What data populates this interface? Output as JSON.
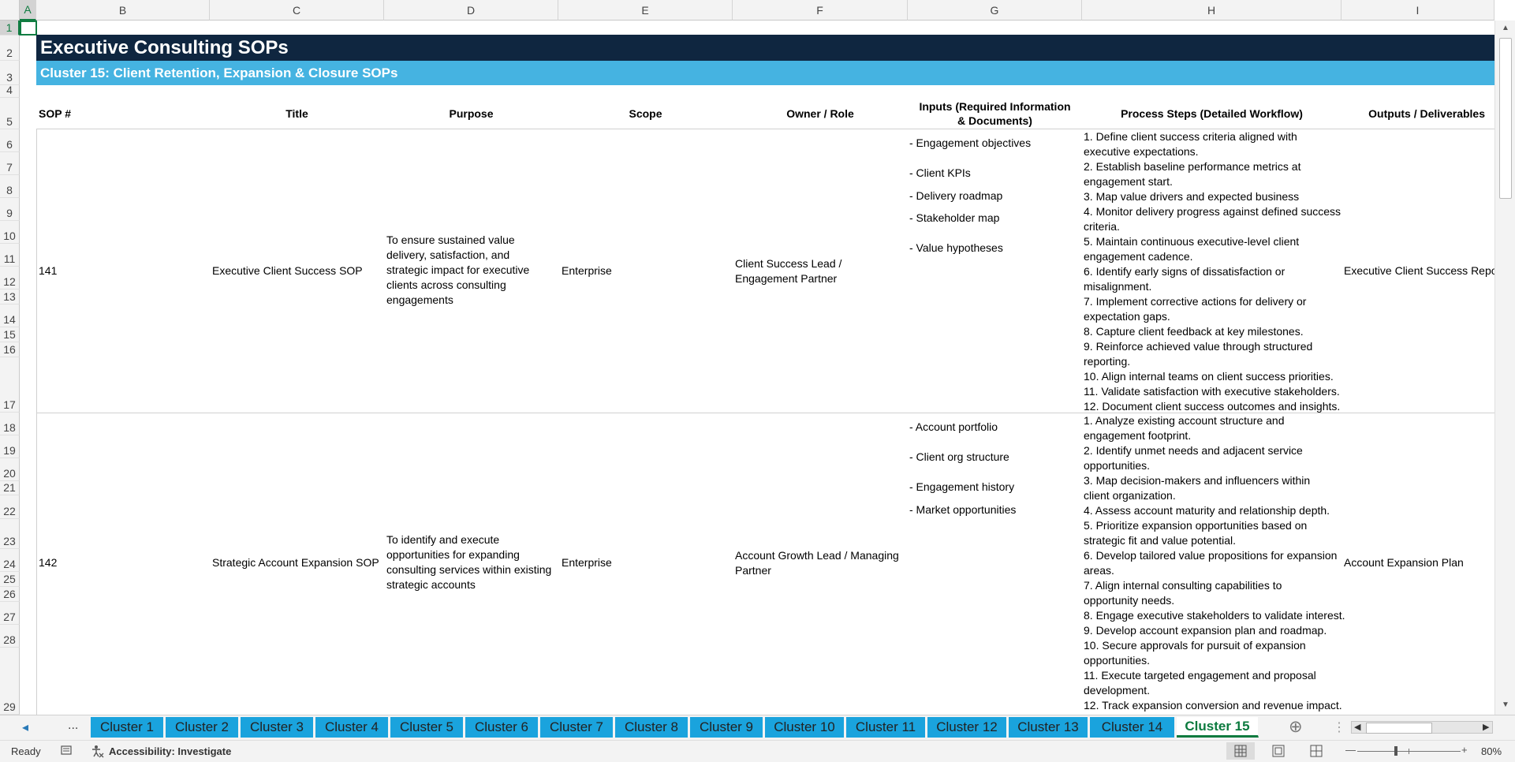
{
  "columns": [
    "A",
    "B",
    "C",
    "D",
    "E",
    "F",
    "G",
    "H",
    "I"
  ],
  "rows": [
    "1",
    "2",
    "3",
    "4",
    "5",
    "6",
    "7",
    "8",
    "9",
    "10",
    "11",
    "12",
    "13",
    "14",
    "15",
    "16",
    "17",
    "18",
    "19",
    "20",
    "21",
    "22",
    "23",
    "24",
    "25",
    "26",
    "27",
    "28",
    "29"
  ],
  "title": "Executive Consulting SOPs",
  "subtitle": "Cluster 15: Client Retention, Expansion & Closure SOPs",
  "headers": {
    "sop": "SOP #",
    "title": "Title",
    "purpose": "Purpose",
    "scope": "Scope",
    "owner": "Owner / Role",
    "inputs": "Inputs (Required Information & Documents)",
    "steps": "Process Steps (Detailed Workflow)",
    "outputs": "Outputs / Deliverables"
  },
  "records": [
    {
      "sop": "141",
      "title": "Executive Client Success SOP",
      "purpose": "To ensure sustained value delivery, satisfaction, and strategic impact for executive clients across consulting engagements",
      "scope": "Enterprise",
      "owner": "Client Success Lead / Engagement Partner",
      "inputs": [
        "- Engagement objectives",
        "- Client KPIs",
        "- Delivery roadmap",
        "- Stakeholder map",
        "- Value hypotheses"
      ],
      "steps": [
        [
          "1. Define client success criteria aligned with",
          "executive expectations."
        ],
        [
          "2. Establish baseline performance metrics at",
          "engagement start."
        ],
        [
          "3. Map value drivers and expected business"
        ],
        [
          "4. Monitor delivery progress against defined success",
          "criteria."
        ],
        [
          "5. Maintain continuous executive-level client",
          "engagement cadence."
        ],
        [
          "6. Identify early signs of dissatisfaction or",
          "misalignment."
        ],
        [
          "7. Implement corrective actions for delivery or",
          "expectation gaps."
        ],
        [
          "8. Capture client feedback at key milestones."
        ],
        [
          "9. Reinforce achieved value through structured",
          "reporting."
        ],
        [
          "10. Align internal teams on client success priorities."
        ],
        [
          "11. Validate satisfaction with executive stakeholders."
        ],
        [
          "12. Document client success outcomes and insights."
        ]
      ],
      "outputs": "Executive Client Success Report"
    },
    {
      "sop": "142",
      "title": "Strategic Account Expansion SOP",
      "purpose": "To identify and execute opportunities for expanding consulting services within existing strategic accounts",
      "scope": "Enterprise",
      "owner": "Account Growth Lead / Managing Partner",
      "inputs": [
        "- Account portfolio",
        "- Client org structure",
        "- Engagement history",
        "- Market opportunities"
      ],
      "steps": [
        [
          "1. Analyze existing account structure and",
          "engagement footprint."
        ],
        [
          "2. Identify unmet needs and adjacent service",
          "opportunities."
        ],
        [
          "3. Map decision-makers and influencers within",
          "client organization."
        ],
        [
          "4. Assess account maturity and relationship depth."
        ],
        [
          "5. Prioritize expansion opportunities based on",
          "strategic fit and value potential."
        ],
        [
          "6. Develop tailored value propositions for expansion",
          "areas."
        ],
        [
          "7. Align internal consulting capabilities to",
          "opportunity needs."
        ],
        [
          "8. Engage executive stakeholders to validate interest."
        ],
        [
          "9. Develop account expansion plan and roadmap."
        ],
        [
          "10. Secure approvals for pursuit of expansion",
          "opportunities."
        ],
        [
          "11. Execute targeted engagement and proposal",
          "development."
        ],
        [
          "12. Track expansion conversion and revenue impact."
        ]
      ],
      "outputs": "Account Expansion Plan"
    }
  ],
  "tabs": [
    "Cluster 1",
    "Cluster 2",
    "Cluster 3",
    "Cluster 4",
    "Cluster 5",
    "Cluster 6",
    "Cluster 7",
    "Cluster 8",
    "Cluster 9",
    "Cluster 10",
    "Cluster 11",
    "Cluster 12",
    "Cluster 13",
    "Cluster 14",
    "Cluster 15"
  ],
  "active_tab": "Cluster 15",
  "tab_nav": {
    "prev": "◂",
    "more": "...",
    "add": "⊕",
    "options": "⋮"
  },
  "status": {
    "ready": "Ready",
    "accessibility": "Accessibility: Investigate",
    "zoom": "80%",
    "zoom_minus": "—",
    "zoom_plus": "+"
  },
  "colors": {
    "title_band": "#0f2640",
    "subtitle_band": "#45b3e1",
    "tab": "#1aa3dd",
    "active_tab_text": "#0b7a3e"
  }
}
